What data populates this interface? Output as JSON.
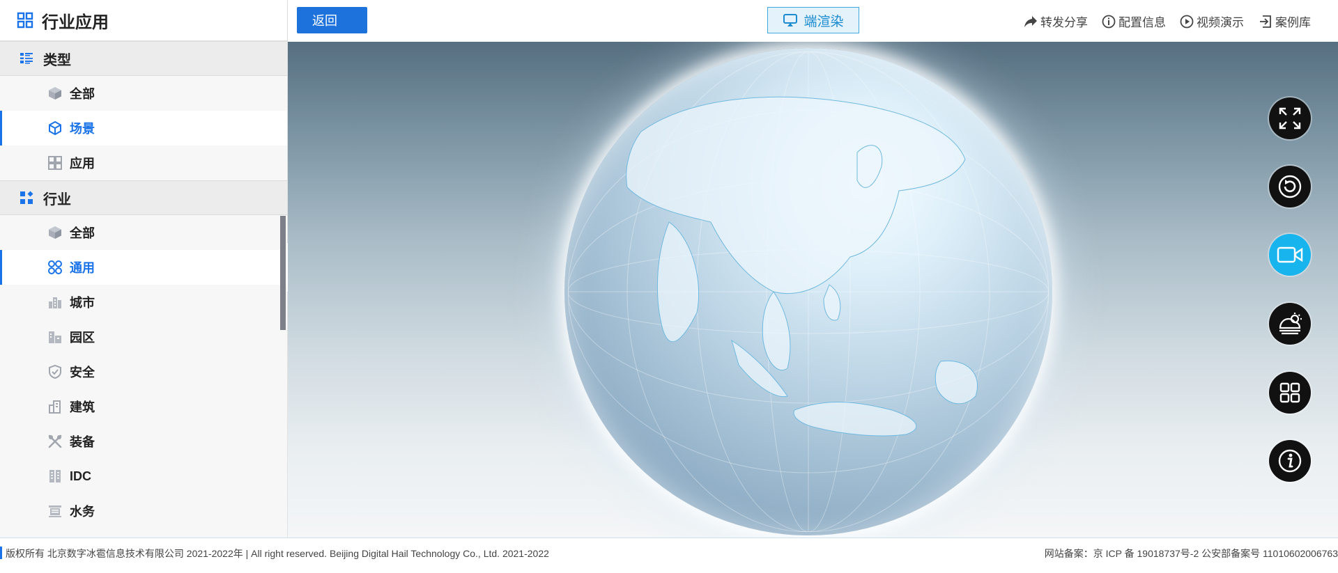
{
  "sidebar": {
    "title": "行业应用",
    "sections": [
      {
        "header": "类型",
        "items": [
          {
            "label": "全部",
            "icon": "cube-icon"
          },
          {
            "label": "场景",
            "icon": "box-outline-icon",
            "active": true
          },
          {
            "label": "应用",
            "icon": "app-grid-icon"
          }
        ]
      },
      {
        "header": "行业",
        "items": [
          {
            "label": "全部",
            "icon": "cube-icon"
          },
          {
            "label": "通用",
            "icon": "four-circles-icon",
            "active": true
          },
          {
            "label": "城市",
            "icon": "city-icon"
          },
          {
            "label": "园区",
            "icon": "park-icon"
          },
          {
            "label": "安全",
            "icon": "shield-icon"
          },
          {
            "label": "建筑",
            "icon": "building-icon"
          },
          {
            "label": "装备",
            "icon": "tools-icon"
          },
          {
            "label": "IDC",
            "icon": "server-icon"
          },
          {
            "label": "水务",
            "icon": "water-icon"
          }
        ]
      }
    ]
  },
  "topbar": {
    "back": "返回",
    "render": "端渲染",
    "share": "转发分享",
    "config": "配置信息",
    "video": "视频演示",
    "cases": "案例库"
  },
  "side_buttons": [
    {
      "name": "fullscreen-icon",
      "active": false
    },
    {
      "name": "rotate-icon",
      "active": false
    },
    {
      "name": "camera-icon",
      "active": true
    },
    {
      "name": "weather-icon",
      "active": false
    },
    {
      "name": "grid-icon",
      "active": false
    },
    {
      "name": "info-icon",
      "active": false
    }
  ],
  "footer": {
    "copyright": "版权所有 北京数字冰雹信息技术有限公司 2021-2022年 | All right reserved. Beijing Digital Hail Technology Co., Ltd. 2021-2022",
    "icp": "网站备案：京 ICP 备 19018737号-2 公安部备案号 11010602006763"
  },
  "colors": {
    "accent": "#1a73e8",
    "render_button_border": "#3ea7de",
    "side_button_active": "#17b4ee"
  }
}
